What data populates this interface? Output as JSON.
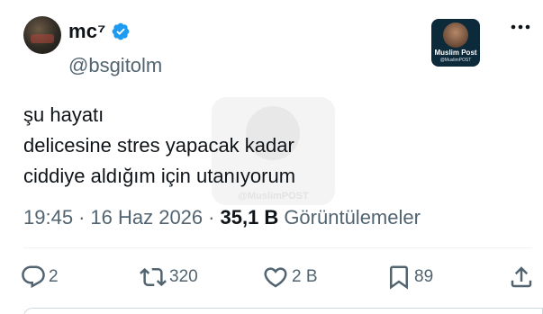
{
  "author": {
    "display_name": "mc⁷",
    "handle": "@bsgitolm",
    "verified": true
  },
  "brand_badge": {
    "title": "Muslim Post",
    "subtitle": "@MuslimPOST"
  },
  "watermark": {
    "text": "@MuslimPOST"
  },
  "tweet": {
    "lines": [
      "şu hayatı",
      "delicesine stres yapacak kadar",
      "ciddiye aldığım için utanıyorum"
    ]
  },
  "meta": {
    "time": "19:45",
    "date": "16 Haz 2026",
    "separator": "·",
    "views_count": "35,1 B",
    "views_label": "Görüntülemeler"
  },
  "actions": {
    "replies": "2",
    "retweets": "320",
    "likes": "2 B",
    "bookmarks": "89"
  },
  "colors": {
    "verified_blue": "#1d9bf0",
    "secondary_text": "#536471",
    "primary_text": "#0f1419"
  },
  "icons": [
    "reply-icon",
    "retweet-icon",
    "like-icon",
    "bookmark-icon",
    "share-icon",
    "more-icon",
    "verified-icon"
  ]
}
